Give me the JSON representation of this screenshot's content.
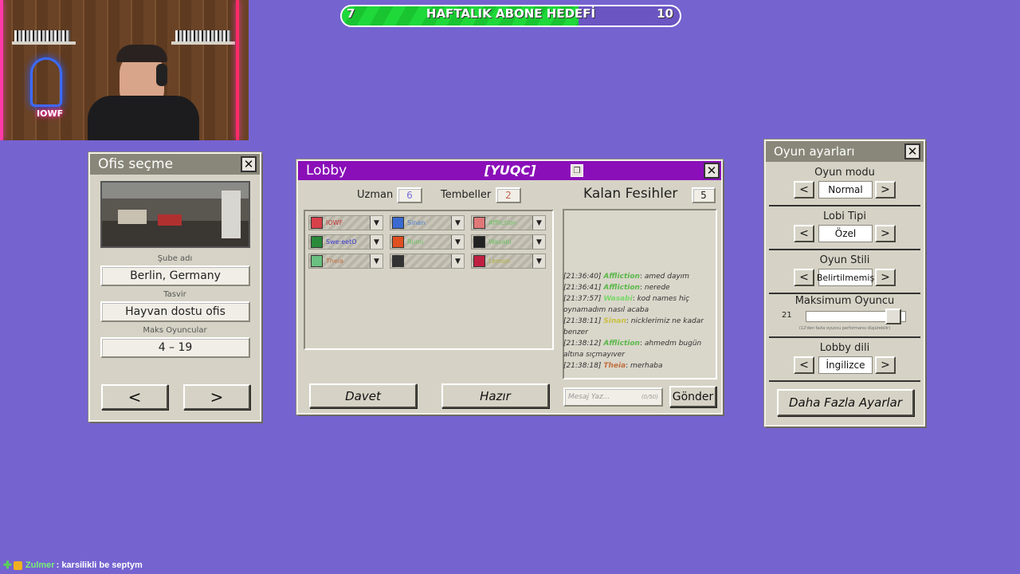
{
  "goal": {
    "current": "7",
    "target": "10",
    "label": "HAFTALIK ABONE HEDEFİ",
    "progress": 0.7,
    "fill_color": "#1fd83a"
  },
  "webcam": {
    "logo_text": "IOWF"
  },
  "office": {
    "title": "Ofis seçme",
    "branch_label": "Şube adı",
    "branch_value": "Berlin, Germany",
    "desc_label": "Tasvir",
    "desc_value": "Hayvan dostu ofis",
    "max_label": "Maks Oyuncular",
    "max_value": "4 – 19",
    "prev": "<",
    "next": ">"
  },
  "lobby": {
    "title": "Lobby",
    "code": "[YUQC]",
    "expert_label": "Uzman",
    "expert_value": "6",
    "lazy_label": "Tembeller",
    "lazy_value": "2",
    "kick_label": "Kalan Fesihler",
    "kick_value": "5",
    "slots": [
      {
        "name": "IOWF",
        "color": "#c03030",
        "avatar": "#d8404a"
      },
      {
        "name": "Sinan",
        "color": "#4a7cd0",
        "avatar": "#3a6ad0"
      },
      {
        "name": "Affliction",
        "color": "#6ac060",
        "avatar": "#e07878"
      },
      {
        "name": "Swe:eetO",
        "color": "#3a3ad0",
        "avatar": "#2a8a3a"
      },
      {
        "name": "Rumi",
        "color": "#6ac060",
        "avatar": "#e05020"
      },
      {
        "name": "Wasabi",
        "color": "#6ac060",
        "avatar": "#222222"
      },
      {
        "name": "Theia",
        "color": "#c07040",
        "avatar": "#6ac080"
      },
      {
        "name": "",
        "color": "#888888",
        "avatar": "#333333"
      },
      {
        "name": "Lemon",
        "color": "#b0b040",
        "avatar": "#c02040"
      }
    ],
    "chat": [
      {
        "ts": "[21:36:40]",
        "who": "Affliction",
        "who_color": "#5ab84a",
        "msg": "amed dayım"
      },
      {
        "ts": "[21:36:41]",
        "who": "Affliction",
        "who_color": "#5ab84a",
        "msg": "nerede"
      },
      {
        "ts": "[21:37:57]",
        "who": "Wasabi",
        "who_color": "#7ad86a",
        "msg": "kod names hiç oynamadım nasıl acaba"
      },
      {
        "ts": "[21:38:11]",
        "who": "Sinan",
        "who_color": "#c8c040",
        "msg": "nicklerimiz ne kadar benzer"
      },
      {
        "ts": "[21:38:12]",
        "who": "Affliction",
        "who_color": "#5ab84a",
        "msg": "ahmedm bugün altına sıçmayıver"
      },
      {
        "ts": "[21:38:18]",
        "who": "Theia",
        "who_color": "#c07040",
        "msg": "merhaba"
      }
    ],
    "invite": "Davet",
    "ready": "Hazır",
    "msg_placeholder": "Mesaj Yaz...",
    "msg_count": "(0/50)",
    "send": "Gönder"
  },
  "settings": {
    "title": "Oyun ayarları",
    "mode_label": "Oyun modu",
    "mode_value": "Normal",
    "type_label": "Lobi Tipi",
    "type_value": "Özel",
    "style_label": "Oyun Stili",
    "style_value": "Belirtilmemiş",
    "max_label": "Maksimum Oyuncu",
    "max_value": "21",
    "max_fraction": 0.95,
    "max_note": "(12'den fazla oyuncu performansı düşürebilir)",
    "lang_label": "Lobby dili",
    "lang_value": "İngilizce",
    "more": "Daha Fazla Ayarlar"
  },
  "stream_chat": {
    "user": "Zulmer",
    "text": ": karsilikli be septym"
  }
}
